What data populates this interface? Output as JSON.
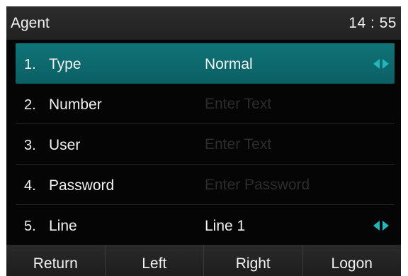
{
  "header": {
    "title": "Agent",
    "clock": "14 : 55"
  },
  "rows": [
    {
      "number": "1.",
      "label": "Type",
      "value": "Normal",
      "selected": true,
      "has_arrows": true
    },
    {
      "number": "2.",
      "label": "Number",
      "placeholder": "Enter Text"
    },
    {
      "number": "3.",
      "label": "User",
      "placeholder": "Enter Text"
    },
    {
      "number": "4.",
      "label": "Password",
      "placeholder": "Enter Password"
    },
    {
      "number": "5.",
      "label": "Line",
      "value": "Line 1",
      "has_arrows": true
    }
  ],
  "softkeys": {
    "return": "Return",
    "left": "Left",
    "right": "Right",
    "logon": "Logon"
  },
  "colors": {
    "screen_background": "#050505",
    "selected_row": "#0f7478",
    "arrow_accent": "#23b6bd",
    "placeholder_text": "#2c2c2c"
  },
  "icons": {
    "selector_arrows": "left-right-arrow-icon"
  }
}
